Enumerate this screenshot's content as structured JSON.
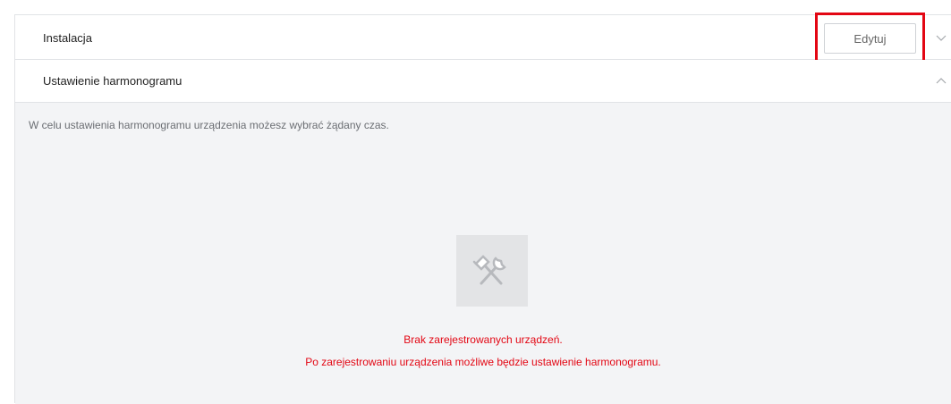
{
  "sections": {
    "installation": {
      "title": "Instalacja",
      "edit_label": "Edytuj",
      "state": "collapsed"
    },
    "schedule": {
      "title": "Ustawienie harmonogramu",
      "state": "expanded",
      "description": "W celu ustawienia harmonogramu urządzenia możesz wybrać żądany czas.",
      "empty_state": {
        "icon": "tools-icon",
        "message_line1": "Brak zarejestrowanych urządzeń.",
        "message_line2": "Po zarejestrowaniu urządzenia możliwe będzie ustawienie harmonogramu."
      }
    }
  },
  "colors": {
    "highlight": "#e30613",
    "error_text": "#e30613",
    "panel_bg": "#f3f4f6",
    "border": "#e1e3e6"
  }
}
